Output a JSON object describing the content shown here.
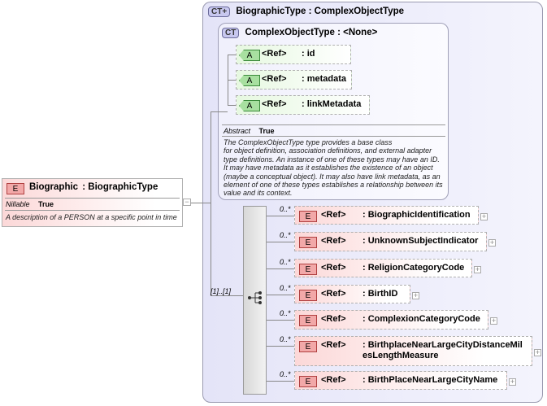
{
  "element": {
    "badge": "E",
    "name": "Biographic",
    "type": ": BiographicType",
    "prop_label": "Nillable",
    "prop_value": "True",
    "description": "A description of a PERSON at a specific point in time",
    "collapse": "−"
  },
  "complex_type": {
    "badge": "CT+",
    "name": "BiographicType",
    "base": ": ComplexObjectType"
  },
  "base_type": {
    "badge": "CT",
    "name": "ComplexObjectType",
    "base": ": <None>",
    "prop_label": "Abstract",
    "prop_value": "True",
    "description": [
      "The ComplexObjectType type provides a base class",
      "for object definition, association definitions, and external adapter",
      "type definitions. An instance of one of these types may have an ID.",
      "It may have metadata as it establishes the existence of an object",
      "(maybe a conceptual object). It may also have link metadata, as an",
      "element of one of these types establishes a relationship between its",
      "value and its context."
    ],
    "attributes": [
      {
        "badge": "A",
        "ref": "<Ref>",
        "name": ": id"
      },
      {
        "badge": "A",
        "ref": "<Ref>",
        "name": ": metadata"
      },
      {
        "badge": "A",
        "ref": "<Ref>",
        "name": ": linkMetadata"
      }
    ]
  },
  "sequence": {
    "occurrence": "[1]..[1]"
  },
  "children": [
    {
      "badge": "E",
      "ref": "<Ref>",
      "occ": "0..*",
      "name": ": BiographicIdentification",
      "name2": ""
    },
    {
      "badge": "E",
      "ref": "<Ref>",
      "occ": "0..*",
      "name": ": UnknownSubjectIndicator",
      "name2": ""
    },
    {
      "badge": "E",
      "ref": "<Ref>",
      "occ": "0..*",
      "name": ": ReligionCategoryCode",
      "name2": ""
    },
    {
      "badge": "E",
      "ref": "<Ref>",
      "occ": "0..*",
      "name": ": BirthID",
      "name2": ""
    },
    {
      "badge": "E",
      "ref": "<Ref>",
      "occ": "0..*",
      "name": ": ComplexionCategoryCode",
      "name2": ""
    },
    {
      "badge": "E",
      "ref": "<Ref>",
      "occ": "0..*",
      "name": ": BirthplaceNearLargeCityDistanceMil",
      "name2": "esLengthMeasure"
    },
    {
      "badge": "E",
      "ref": "<Ref>",
      "occ": "0..*",
      "name": ": BirthPlaceNearLargeCityName",
      "name2": ""
    }
  ],
  "expand": "+"
}
